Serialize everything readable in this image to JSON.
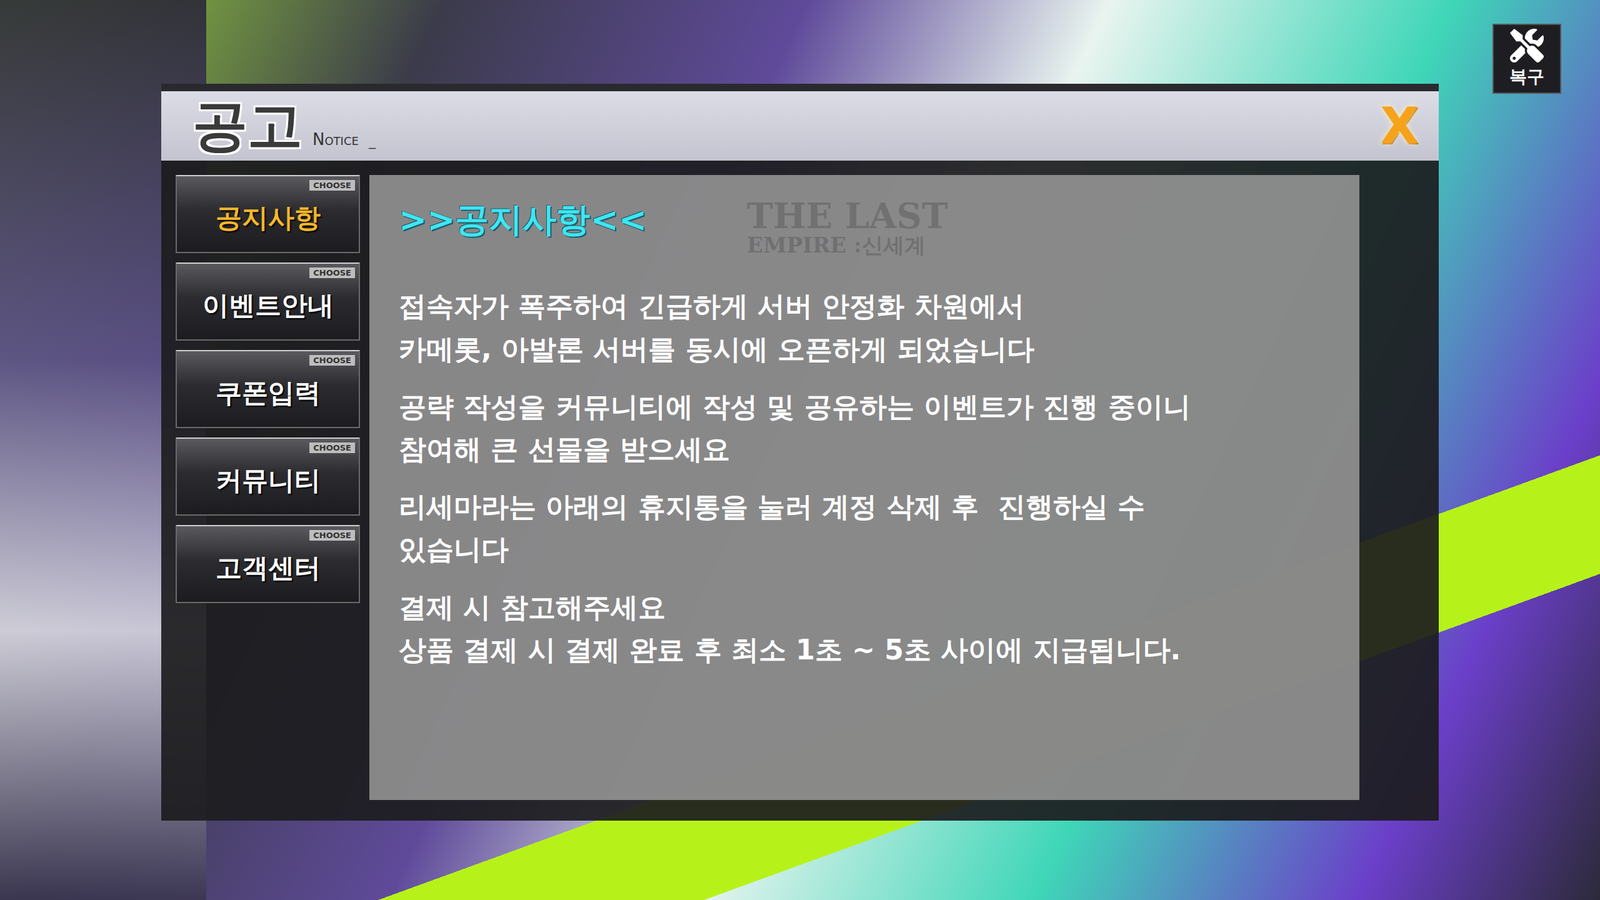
{
  "window": {
    "title": "공고",
    "subtitle": "Notice",
    "cursor": "_",
    "close": "X"
  },
  "restore_button": {
    "label": "복구"
  },
  "sidebar": {
    "tag": "CHOOSE",
    "items": [
      {
        "label": "공지사항",
        "selected": true
      },
      {
        "label": "이벤트안내",
        "selected": false
      },
      {
        "label": "쿠폰입력",
        "selected": false
      },
      {
        "label": "커뮤니티",
        "selected": false
      },
      {
        "label": "고객센터",
        "selected": false
      }
    ]
  },
  "content": {
    "title": ">>공지사항<<",
    "watermark": [
      "THE LAST",
      "EMPIRE :신세계"
    ],
    "paragraphs": [
      [
        "접속자가 폭주하여 긴급하게 서버 안정화 차원에서",
        "카메롯, 아발론 서버를 동시에 오픈하게 되었습니다"
      ],
      [
        "공략 작성을 커뮤니티에 작성 및 공유하는 이벤트가 진행 중이니",
        "참여해 큰 선물을 받으세요"
      ],
      [
        "리세마라는 아래의 휴지통을 눌러 계정 삭제 후  진행하실 수",
        "있습니다"
      ],
      [
        "결제 시 참고해주세요",
        "상품 결제 시 결제 완료 후 최소 1초 ~ 5초 사이에 지급됩니다."
      ]
    ]
  }
}
